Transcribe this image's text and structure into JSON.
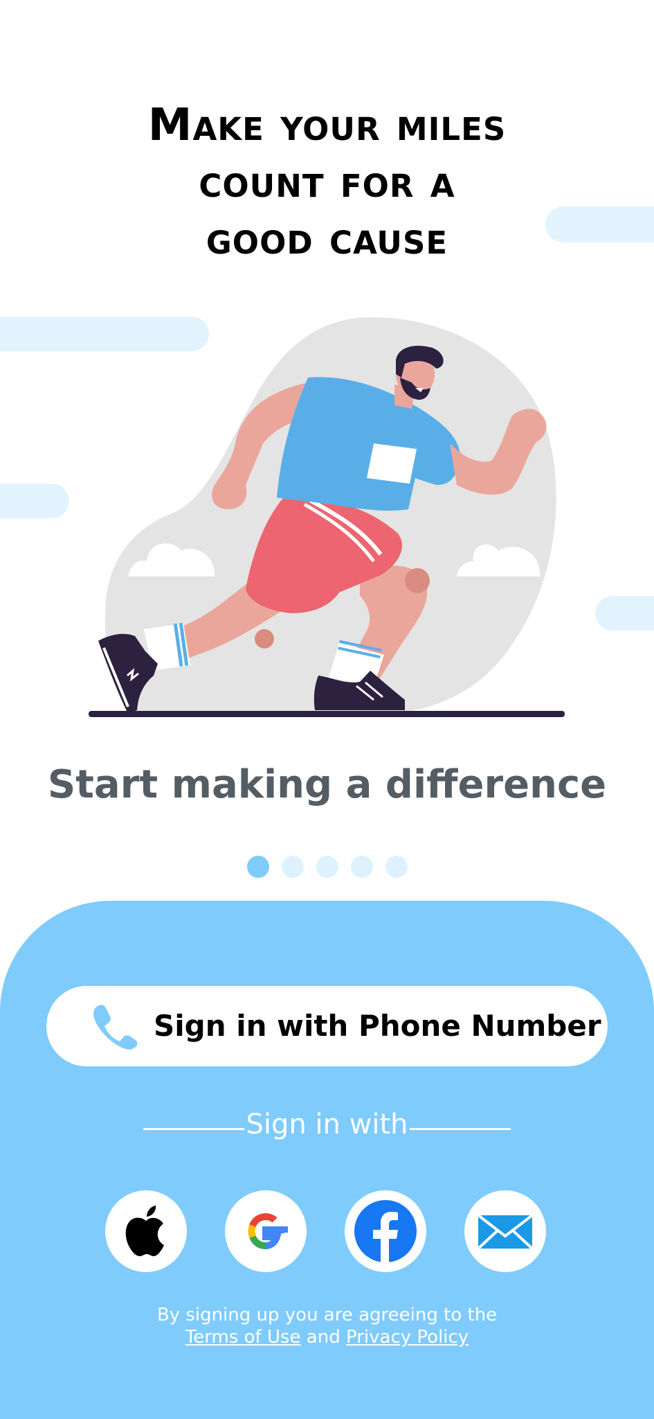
{
  "headline": {
    "line1": "Make your miles",
    "line2": "count for a",
    "line3": "good cause"
  },
  "subtitle": "Start making a difference",
  "pagination": {
    "total": 5,
    "active_index": 0
  },
  "phone_signin": {
    "label": "Sign in with Phone Number",
    "icon": "phone-icon"
  },
  "divider_text": "Sign in with",
  "social": [
    {
      "id": "apple",
      "icon": "apple-icon"
    },
    {
      "id": "google",
      "icon": "google-icon"
    },
    {
      "id": "facebook",
      "icon": "facebook-icon"
    },
    {
      "id": "email",
      "icon": "email-icon"
    }
  ],
  "legal": {
    "line1": "By signing up you are agreeing to the",
    "terms": "Terms of Use",
    "and": "and",
    "privacy": "Privacy Policy"
  },
  "colors": {
    "accent_light": "#7fcbfc",
    "dot_inactive": "#ddf2fe",
    "cloud": "#e3f3fd",
    "subtitle": "#545c64"
  }
}
